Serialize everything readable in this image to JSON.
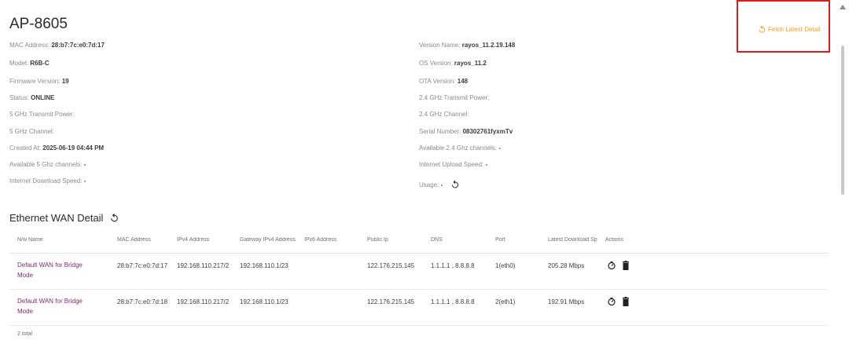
{
  "device": {
    "title": "AP-8605",
    "left_fields": [
      {
        "label": "MAC Address: ",
        "value": "28:b7:7c:e0:7d:17"
      },
      {
        "label": "Model: ",
        "value": "R6B-C"
      },
      {
        "label": "Firmware Version: ",
        "value": "19"
      },
      {
        "label": "Status: ",
        "value": "ONLINE"
      },
      {
        "label": "5 GHz Transmit Power:",
        "value": ""
      },
      {
        "label": "5 GHz Channel:",
        "value": ""
      },
      {
        "label": "Created At: ",
        "value": "2025-06-19 04:44 PM"
      },
      {
        "label": "Available 5 Ghz channels: ",
        "value": "-"
      },
      {
        "label": "Internet Download Speed: ",
        "value": "-"
      }
    ],
    "right_fields": [
      {
        "label": "Version Name: ",
        "value": "rayos_11.2.19.148"
      },
      {
        "label": "OS Version: ",
        "value": "rayos_11.2"
      },
      {
        "label": "OTA Version: ",
        "value": "148"
      },
      {
        "label": "2.4 GHz Transmit Power:",
        "value": ""
      },
      {
        "label": "2.4 GHz Channel:",
        "value": ""
      },
      {
        "label": "Serial Number: ",
        "value": "08302761fyxmTv"
      },
      {
        "label": "Available 2.4 Ghz channels: ",
        "value": "-"
      },
      {
        "label": "Internet Upload Speed: ",
        "value": "-"
      },
      {
        "label": "Usage: ",
        "value": "-"
      }
    ]
  },
  "fetch_button": {
    "label": "Fetch Latest Detail"
  },
  "wan": {
    "title": "Ethernet WAN Detail",
    "columns": [
      "N/w Name",
      "MAC Address",
      "IPv4 Address",
      "Gateway IPv4 Address",
      "IPv6 Address",
      "Public Ip",
      "DNS",
      "Port",
      "Latest Download Sp",
      "Actions"
    ],
    "rows": [
      {
        "name": "Default WAN for Bridge Mode",
        "mac": "28:b7:7c:e0:7d:17",
        "ipv4": "192.168.110.217/2",
        "gateway": "192.168.110.1/23",
        "ipv6": "",
        "public_ip": "122.176.215.145",
        "dns": "1.1.1.1 , 8.8.8.8",
        "port": "1(eth0)",
        "download": "205.28 Mbps"
      },
      {
        "name": "Default WAN for Bridge Mode",
        "mac": "28:b7:7c:e0:7d:18",
        "ipv4": "192.168.110.217/2",
        "gateway": "192.168.110.1/23",
        "ipv6": "",
        "public_ip": "122.176.215.145",
        "dns": "1.1.1.1 , 8.8.8.8",
        "port": "2(eth1)",
        "download": "192.91 Mbps"
      }
    ],
    "total": "2 total"
  },
  "colors": {
    "accent": "#f39c12",
    "link": "#7b2d6e",
    "highlight_border": "#e01b1b"
  },
  "icons": {
    "refresh": "refresh-icon",
    "speedtest": "speedometer-icon",
    "delete": "trash-icon"
  }
}
